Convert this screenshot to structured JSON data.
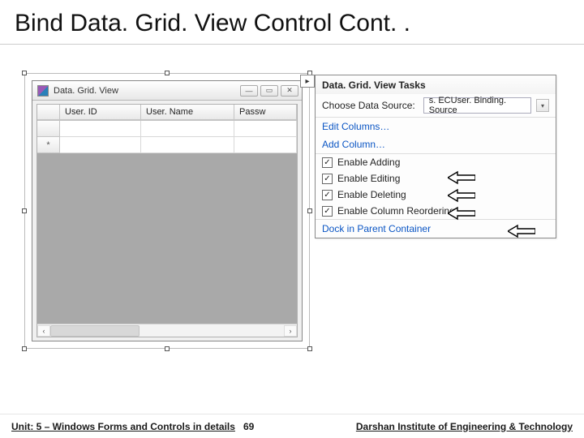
{
  "slide": {
    "title": "Bind Data. Grid. View Control Cont. ."
  },
  "window": {
    "title": "Data. Grid. View"
  },
  "grid": {
    "columns": [
      "User. ID",
      "User. Name",
      "Passw"
    ],
    "new_row_glyph": "*"
  },
  "tasks": {
    "title": "Data. Grid. View Tasks",
    "data_source_label": "Choose Data Source:",
    "data_source_value": "s. ECUser. Binding. Source",
    "edit_columns": "Edit Columns…",
    "add_column": "Add Column…",
    "checks": [
      {
        "label": "Enable Adding",
        "checked": true
      },
      {
        "label": "Enable Editing",
        "checked": true
      },
      {
        "label": "Enable Deleting",
        "checked": true
      },
      {
        "label": "Enable Column Reordering",
        "checked": true
      }
    ],
    "dock": "Dock in Parent Container"
  },
  "footer": {
    "unit": "Unit: 5 – Windows Forms and Controls in details",
    "page": "69",
    "institute": "Darshan Institute of Engineering & Technology"
  }
}
